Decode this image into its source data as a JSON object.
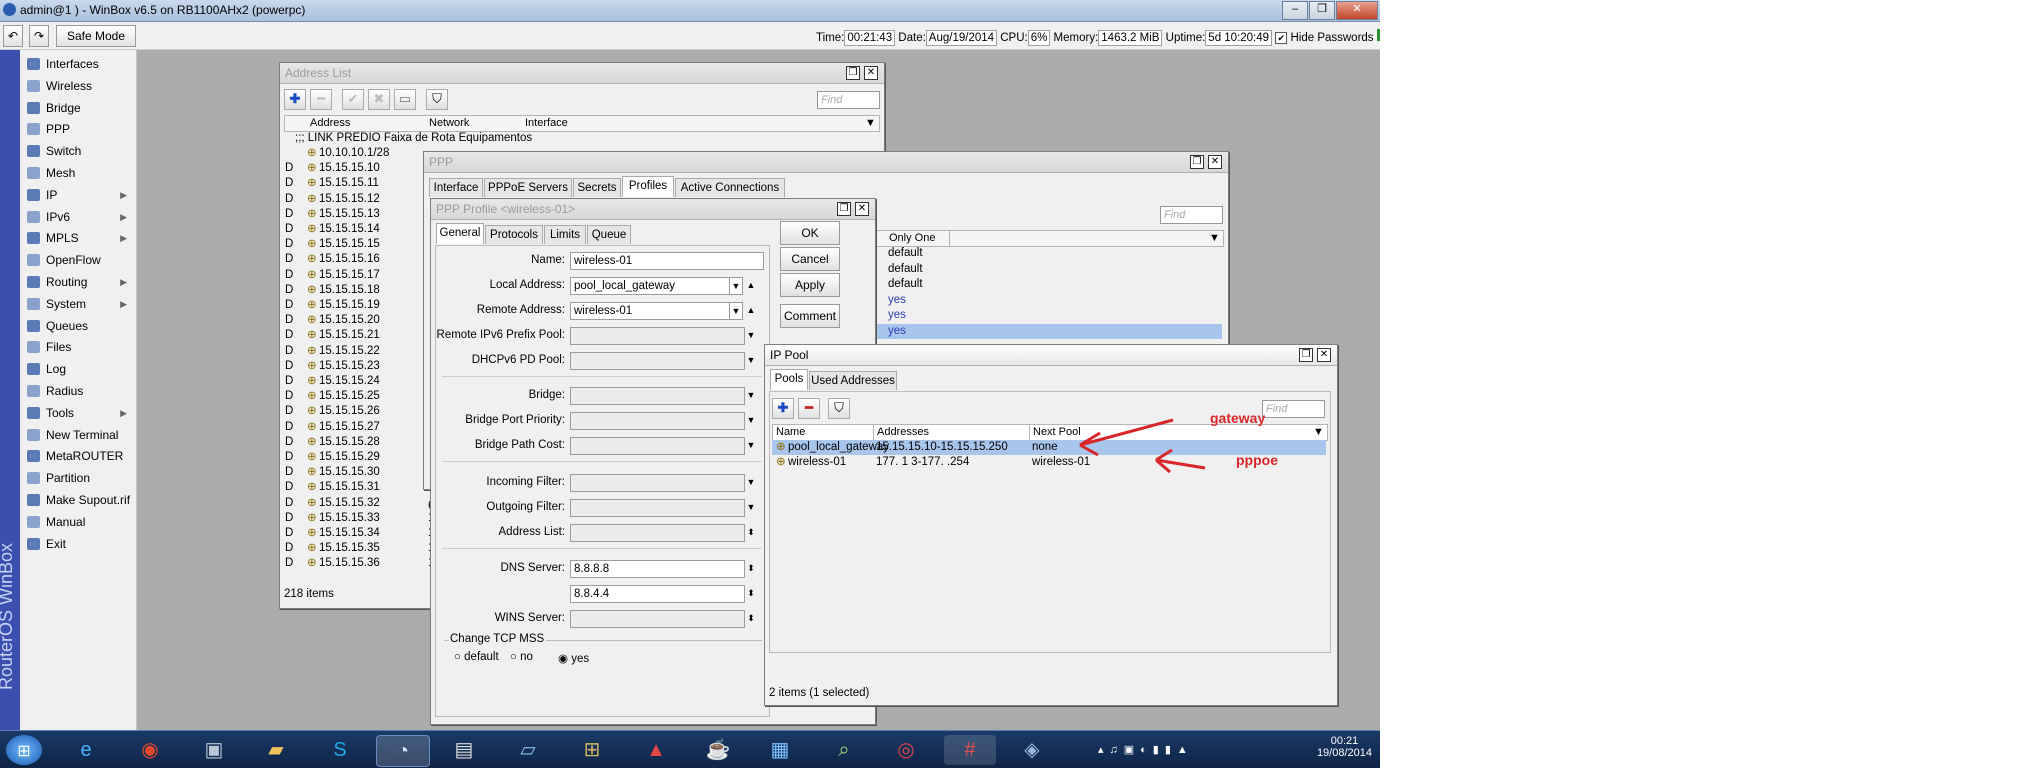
{
  "titlebar": {
    "title": "admin@1              ) - WinBox v6.5 on RB1100AHx2 (powerpc)"
  },
  "toolbar": {
    "safe_mode": "Safe Mode",
    "time_label": "Time:",
    "time": "00:21:43",
    "date_label": "Date:",
    "date": "Aug/19/2014",
    "cpu_label": "CPU:",
    "cpu": "6%",
    "memory_label": "Memory:",
    "memory": "1463.2 MiB",
    "uptime_label": "Uptime:",
    "uptime": "5d 10:20:49",
    "hide_passwords": "Hide Passwords"
  },
  "sidebar": {
    "brand": "RouterOS WinBox",
    "items": [
      {
        "label": "Interfaces",
        "icon": "interfaces-icon",
        "sub": false
      },
      {
        "label": "Wireless",
        "icon": "wireless-icon",
        "sub": false
      },
      {
        "label": "Bridge",
        "icon": "bridge-icon",
        "sub": false
      },
      {
        "label": "PPP",
        "icon": "ppp-icon",
        "sub": false
      },
      {
        "label": "Switch",
        "icon": "switch-icon",
        "sub": false
      },
      {
        "label": "Mesh",
        "icon": "mesh-icon",
        "sub": false
      },
      {
        "label": "IP",
        "icon": "ip-icon",
        "sub": true
      },
      {
        "label": "IPv6",
        "icon": "ipv6-icon",
        "sub": true
      },
      {
        "label": "MPLS",
        "icon": "mpls-icon",
        "sub": true
      },
      {
        "label": "OpenFlow",
        "icon": "openflow-icon",
        "sub": false
      },
      {
        "label": "Routing",
        "icon": "routing-icon",
        "sub": true
      },
      {
        "label": "System",
        "icon": "system-icon",
        "sub": true
      },
      {
        "label": "Queues",
        "icon": "queues-icon",
        "sub": false
      },
      {
        "label": "Files",
        "icon": "files-icon",
        "sub": false
      },
      {
        "label": "Log",
        "icon": "log-icon",
        "sub": false
      },
      {
        "label": "Radius",
        "icon": "radius-icon",
        "sub": false
      },
      {
        "label": "Tools",
        "icon": "tools-icon",
        "sub": true
      },
      {
        "label": "New Terminal",
        "icon": "terminal-icon",
        "sub": false
      },
      {
        "label": "MetaROUTER",
        "icon": "metarouter-icon",
        "sub": false
      },
      {
        "label": "Partition",
        "icon": "partition-icon",
        "sub": false
      },
      {
        "label": "Make Supout.rif",
        "icon": "supout-icon",
        "sub": false
      },
      {
        "label": "Manual",
        "icon": "manual-icon",
        "sub": false
      },
      {
        "label": "Exit",
        "icon": "exit-icon",
        "sub": false
      }
    ]
  },
  "address_list": {
    "title": "Address List",
    "find": "Find",
    "columns": [
      "Address",
      "Network",
      "Interface"
    ],
    "comment": ";;; LINK PREDIO Faixa de Rota Equipamentos",
    "rows": [
      {
        "flag": "",
        "address": "10.10.10.1/28",
        "network": ""
      },
      {
        "flag": "D",
        "address": "15.15.15.10",
        "network": ""
      },
      {
        "flag": "D",
        "address": "15.15.15.11",
        "network": ""
      },
      {
        "flag": "D",
        "address": "15.15.15.12",
        "network": ""
      },
      {
        "flag": "D",
        "address": "15.15.15.13",
        "network": ""
      },
      {
        "flag": "D",
        "address": "15.15.15.14",
        "network": ""
      },
      {
        "flag": "D",
        "address": "15.15.15.15",
        "network": ""
      },
      {
        "flag": "D",
        "address": "15.15.15.16",
        "network": ""
      },
      {
        "flag": "D",
        "address": "15.15.15.17",
        "network": ""
      },
      {
        "flag": "D",
        "address": "15.15.15.18",
        "network": ""
      },
      {
        "flag": "D",
        "address": "15.15.15.19",
        "network": ""
      },
      {
        "flag": "D",
        "address": "15.15.15.20",
        "network": ""
      },
      {
        "flag": "D",
        "address": "15.15.15.21",
        "network": ""
      },
      {
        "flag": "D",
        "address": "15.15.15.22",
        "network": ""
      },
      {
        "flag": "D",
        "address": "15.15.15.23",
        "network": ""
      },
      {
        "flag": "D",
        "address": "15.15.15.24",
        "network": ""
      },
      {
        "flag": "D",
        "address": "15.15.15.25",
        "network": ""
      },
      {
        "flag": "D",
        "address": "15.15.15.26",
        "network": ""
      },
      {
        "flag": "D",
        "address": "15.15.15.27",
        "network": ""
      },
      {
        "flag": "D",
        "address": "15.15.15.28",
        "network": ""
      },
      {
        "flag": "D",
        "address": "15.15.15.29",
        "network": ""
      },
      {
        "flag": "D",
        "address": "15.15.15.30",
        "network": ""
      },
      {
        "flag": "D",
        "address": "15.15.15.31",
        "network": ""
      },
      {
        "flag": "D",
        "address": "15.15.15.32",
        "network": ""
      },
      {
        "flag": "D",
        "address": "15.15.15.33",
        "network": "1("
      },
      {
        "flag": "D",
        "address": "15.15.15.34",
        "network": "1("
      },
      {
        "flag": "D",
        "address": "15.15.15.35",
        "network": "17"
      },
      {
        "flag": "D",
        "address": "15.15.15.36",
        "network": "17"
      }
    ],
    "status": "218 items"
  },
  "ppp": {
    "title": "PPP",
    "tabs": [
      "Interface",
      "PPPoE Servers",
      "Secrets",
      "Profiles",
      "Active Connections"
    ],
    "find": "Find",
    "col_only_one": "Only One",
    "only_one_values": [
      "default",
      "default",
      "default",
      "yes",
      "yes",
      "yes"
    ],
    "left_digit": "6"
  },
  "ppp_profile": {
    "title": "PPP Profile <wireless-01>",
    "tabs": [
      "General",
      "Protocols",
      "Limits",
      "Queue"
    ],
    "name_label": "Name:",
    "name": "wireless-01",
    "local_label": "Local Address:",
    "local": "pool_local_gateway",
    "remote_label": "Remote Address:",
    "remote": "wireless-01",
    "ipv6_label": "Remote IPv6 Prefix Pool:",
    "dhcpv6_label": "DHCPv6 PD Pool:",
    "bridge_label": "Bridge:",
    "bridge_prio_label": "Bridge Port Priority:",
    "bridge_cost_label": "Bridge Path Cost:",
    "in_filter_label": "Incoming Filter:",
    "out_filter_label": "Outgoing Filter:",
    "addr_list_label": "Address List:",
    "dns_label": "DNS Server:",
    "dns1": "8.8.8.8",
    "dns2": "8.8.4.4",
    "wins_label": "WINS Server:",
    "tcp_mss_label": "Change TCP MSS",
    "radio_default": "default",
    "radio_no": "no",
    "radio_yes": "yes",
    "ok": "OK",
    "cancel": "Cancel",
    "apply": "Apply",
    "comment": "Comment"
  },
  "ip_pool": {
    "title": "IP Pool",
    "tabs": [
      "Pools",
      "Used Addresses"
    ],
    "find": "Find",
    "columns": [
      "Name",
      "Addresses",
      "Next Pool"
    ],
    "rows": [
      {
        "name": "pool_local_gateway",
        "addresses": "15.15.15.10-15.15.15.250",
        "next": "none"
      },
      {
        "name": "wireless-01",
        "addresses": "177.    1    3-177.           .254",
        "next": "wireless-01"
      }
    ],
    "status": "2 items (1 selected)",
    "annotation_gateway": "gateway",
    "annotation_pppoe": "pppoe"
  },
  "taskbar": {
    "clock": "00:21",
    "date": "19/08/2014"
  },
  "colors": {
    "accent": "#3a4fae",
    "selection": "#a8c5ec",
    "annotation": "#d8262a"
  }
}
